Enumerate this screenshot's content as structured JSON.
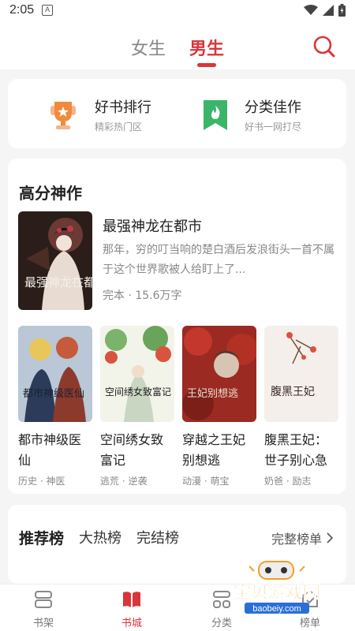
{
  "status": {
    "time": "2:05",
    "icon_a": "A"
  },
  "tabs": {
    "female": "女生",
    "male": "男生"
  },
  "quick": {
    "rank_title": "好书排行",
    "rank_sub": "精彩热门区",
    "cat_title": "分类佳作",
    "cat_sub": "好书一网打尽"
  },
  "high": {
    "title": "高分神作",
    "featured": {
      "title": "最强神龙在都市",
      "desc": "那年，穷的叮当响的楚白酒后发浪街头一首不属于这个世界歌被人给盯上了...",
      "meta": "完本 · 15.6万字",
      "cover_text": "最强神龙在都市"
    },
    "books": [
      {
        "title": "都市神级医仙",
        "tags": "历史 · 神医",
        "cover_text": "都市神级医仙"
      },
      {
        "title": "空间绣女致富记",
        "tags": "逃荒 · 逆袭",
        "cover_text": "空间绣女致富记"
      },
      {
        "title": "穿越之王妃别想逃",
        "tags": "动漫 · 萌宝",
        "cover_text": "王妃别想逃"
      },
      {
        "title": "腹黑王妃：世子别心急",
        "tags": "奶爸 · 励志",
        "cover_text": "腹黑王妃"
      }
    ]
  },
  "ranking": {
    "tabs": [
      "推荐榜",
      "大热榜",
      "完结榜"
    ],
    "full": "完整榜单"
  },
  "bottom_nav": [
    "书架",
    "书城",
    "分类",
    "榜单"
  ],
  "watermark": {
    "text": "宝贝游戏网",
    "url": "baobeiy.com"
  },
  "colors": {
    "accent": "#d9353a",
    "orange": "#f08a3c",
    "green": "#3bb56a"
  }
}
